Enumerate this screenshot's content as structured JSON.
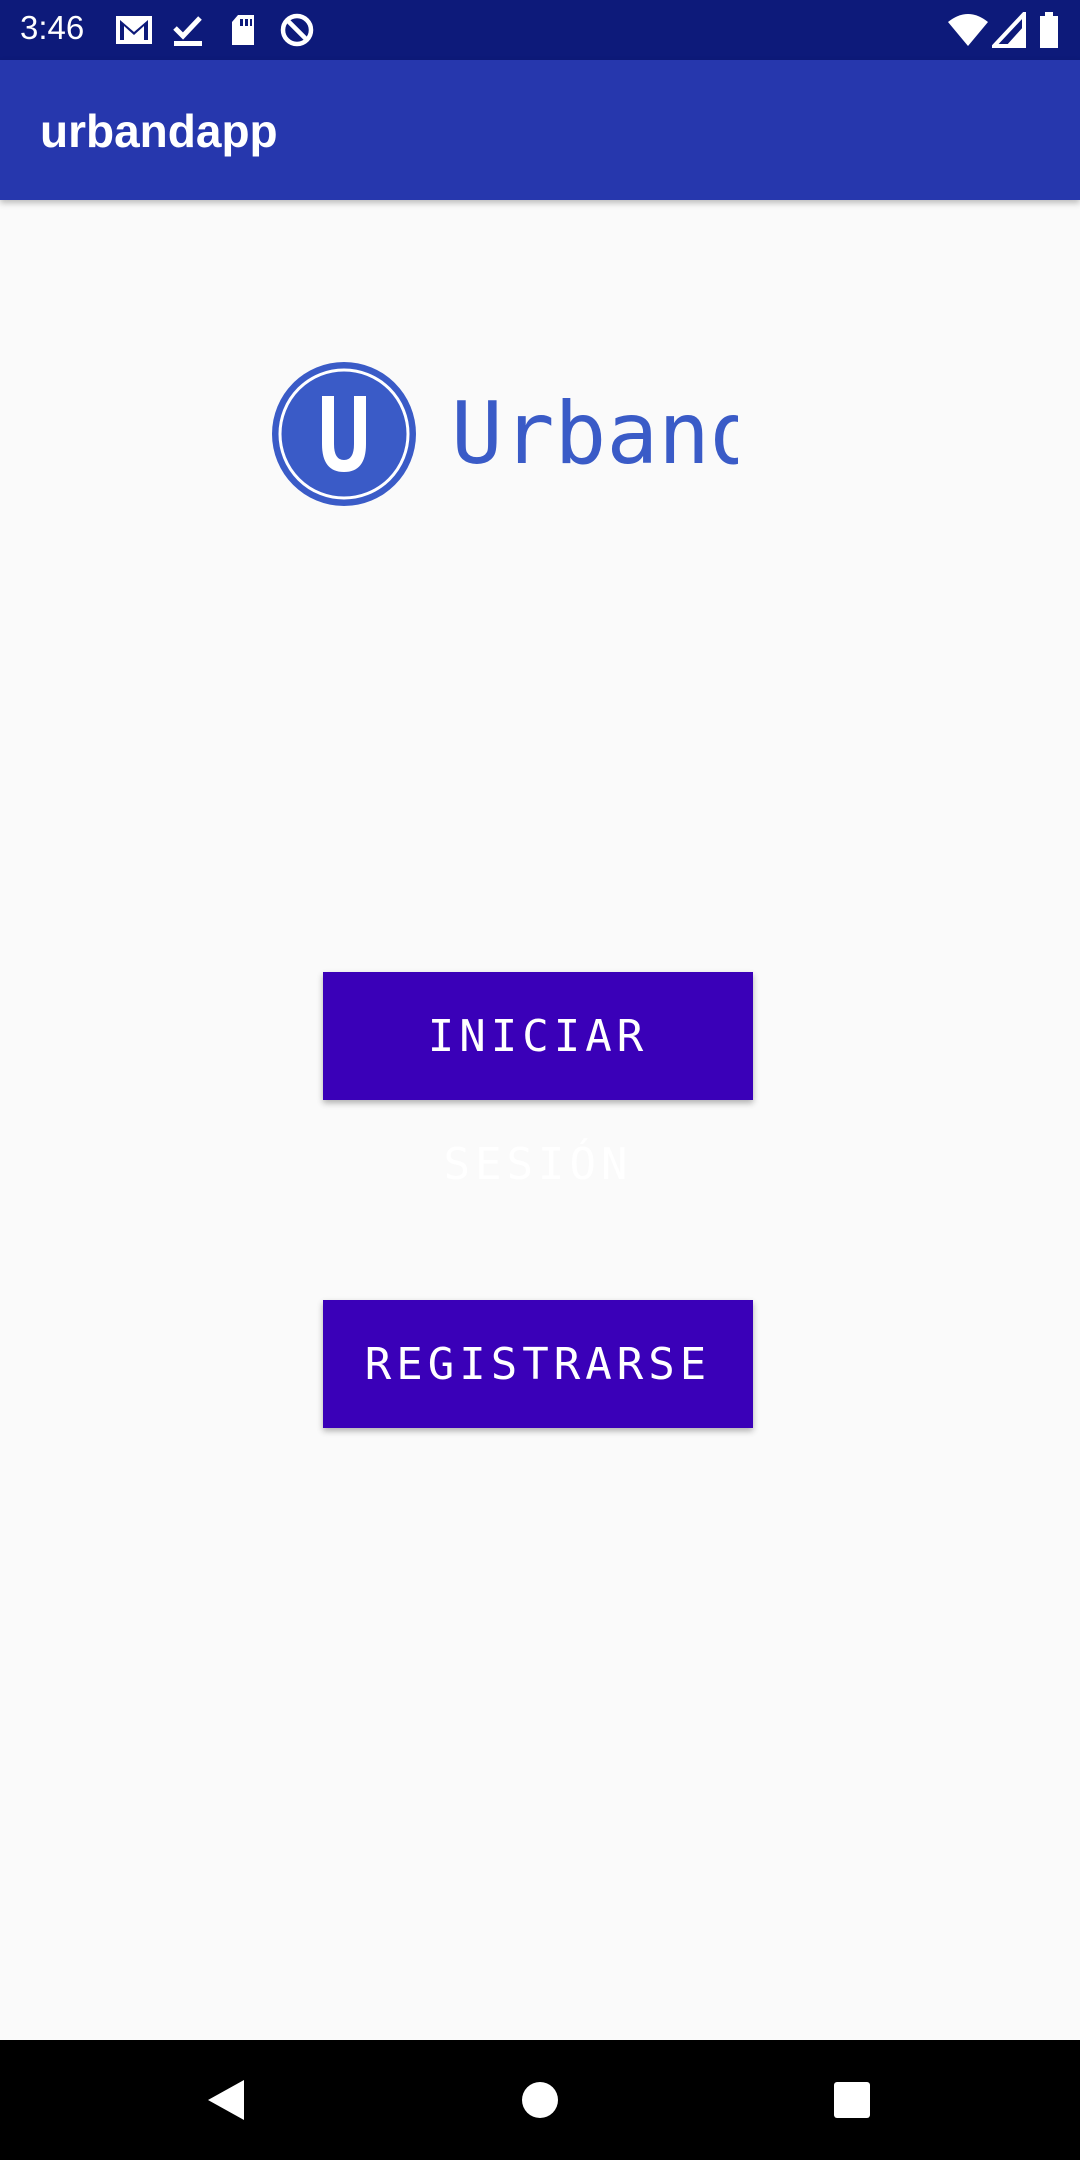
{
  "status_bar": {
    "time": "3:46",
    "icons": [
      "gmail-icon",
      "task-check-icon",
      "sd-card-icon",
      "do-not-disturb-icon",
      "wifi-icon",
      "signal-icon",
      "battery-icon"
    ]
  },
  "app_bar": {
    "title": "urbandapp"
  },
  "logo": {
    "text": "Urband",
    "letter": "U",
    "color": "#3a5bc7"
  },
  "actions": {
    "login_label": "INICIAR SESIÓN",
    "register_label": "REGISTRARSE"
  },
  "nav_bar": {
    "icons": [
      "back-icon",
      "home-icon",
      "recents-icon"
    ]
  },
  "colors": {
    "status_bar": "#0d1a7a",
    "app_bar": "#2637ad",
    "button": "#3a00b8",
    "background": "#fafafa"
  }
}
